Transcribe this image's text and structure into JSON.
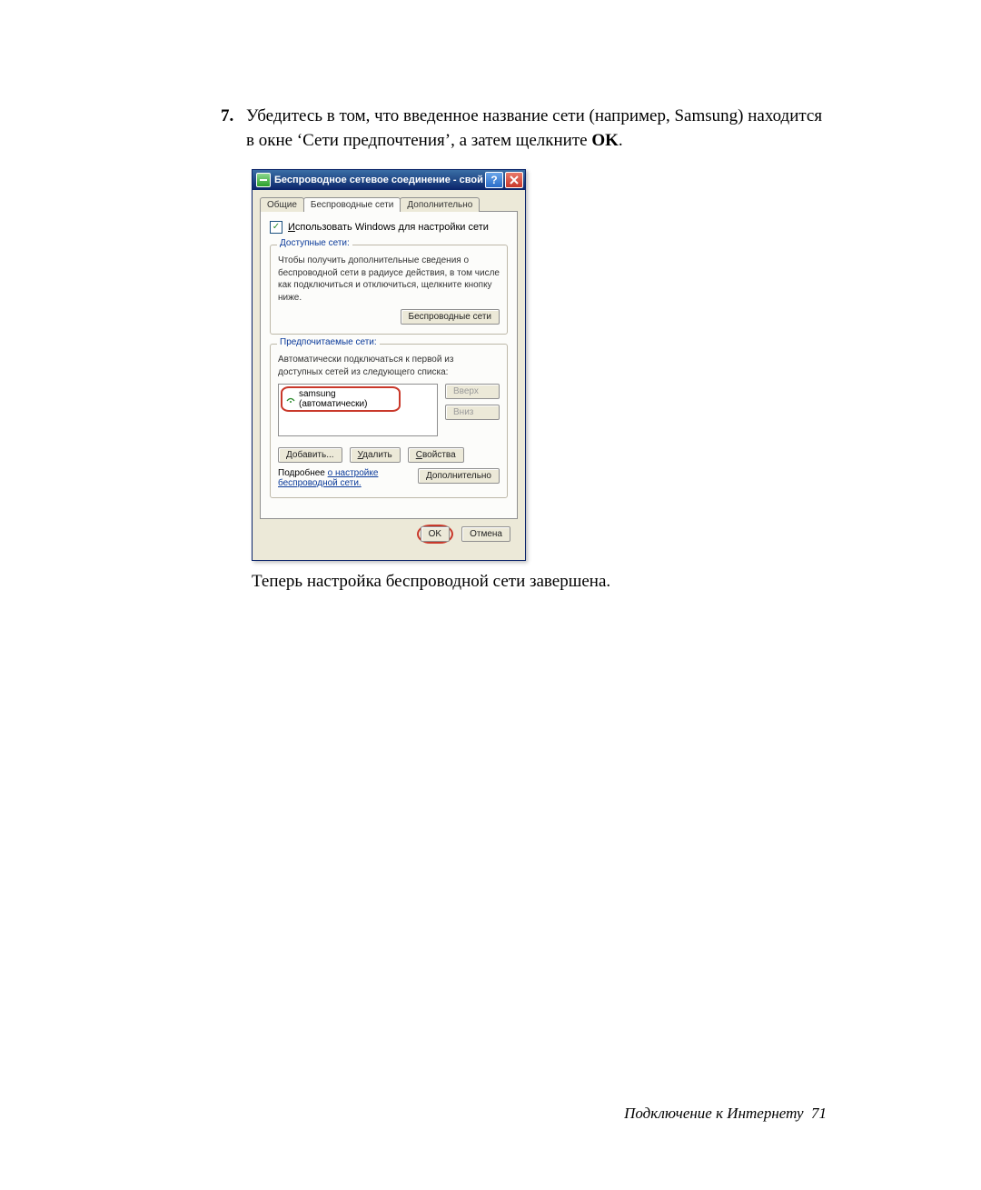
{
  "step": {
    "number": "7.",
    "text_a": "Убедитесь в том, что введенное название сети (например, Samsung) находится в окне ‘Сети предпочтения’, а затем щелкните ",
    "text_bold": "OK",
    "text_b": "."
  },
  "dialog": {
    "title": "Беспроводное сетевое соединение - свой…",
    "tabs": {
      "general": "Общие",
      "wireless": "Беспроводные сети",
      "advanced": "Дополнительно"
    },
    "use_windows_label_pre": "И",
    "use_windows_label": "спользовать Windows для настройки сети",
    "available": {
      "legend": "Доступные сети:",
      "text": "Чтобы получить дополнительные сведения о беспроводной сети в радиусе действия, в том числе как подключиться и отключиться, щелкните кнопку ниже.",
      "button": "Беспроводные сети"
    },
    "preferred": {
      "legend": "Предпочитаемые сети:",
      "text": "Автоматически подключаться к первой из доступных сетей из следующего списка:",
      "item": "samsung (автоматически)",
      "btn_up": "Вверх",
      "btn_down": "Вниз",
      "btn_add": "Добавить...",
      "btn_remove": "Удалить",
      "btn_props": "Свойства"
    },
    "more_pre": "Подробнее ",
    "more_link": "о настройке беспроводной сети.",
    "btn_advanced": "Дополнительно",
    "btn_ok": "OK",
    "btn_cancel": "Отмена"
  },
  "after": "Теперь настройка беспроводной сети завершена.",
  "footer": {
    "label": "Подключение к Интернету",
    "page": "71"
  }
}
